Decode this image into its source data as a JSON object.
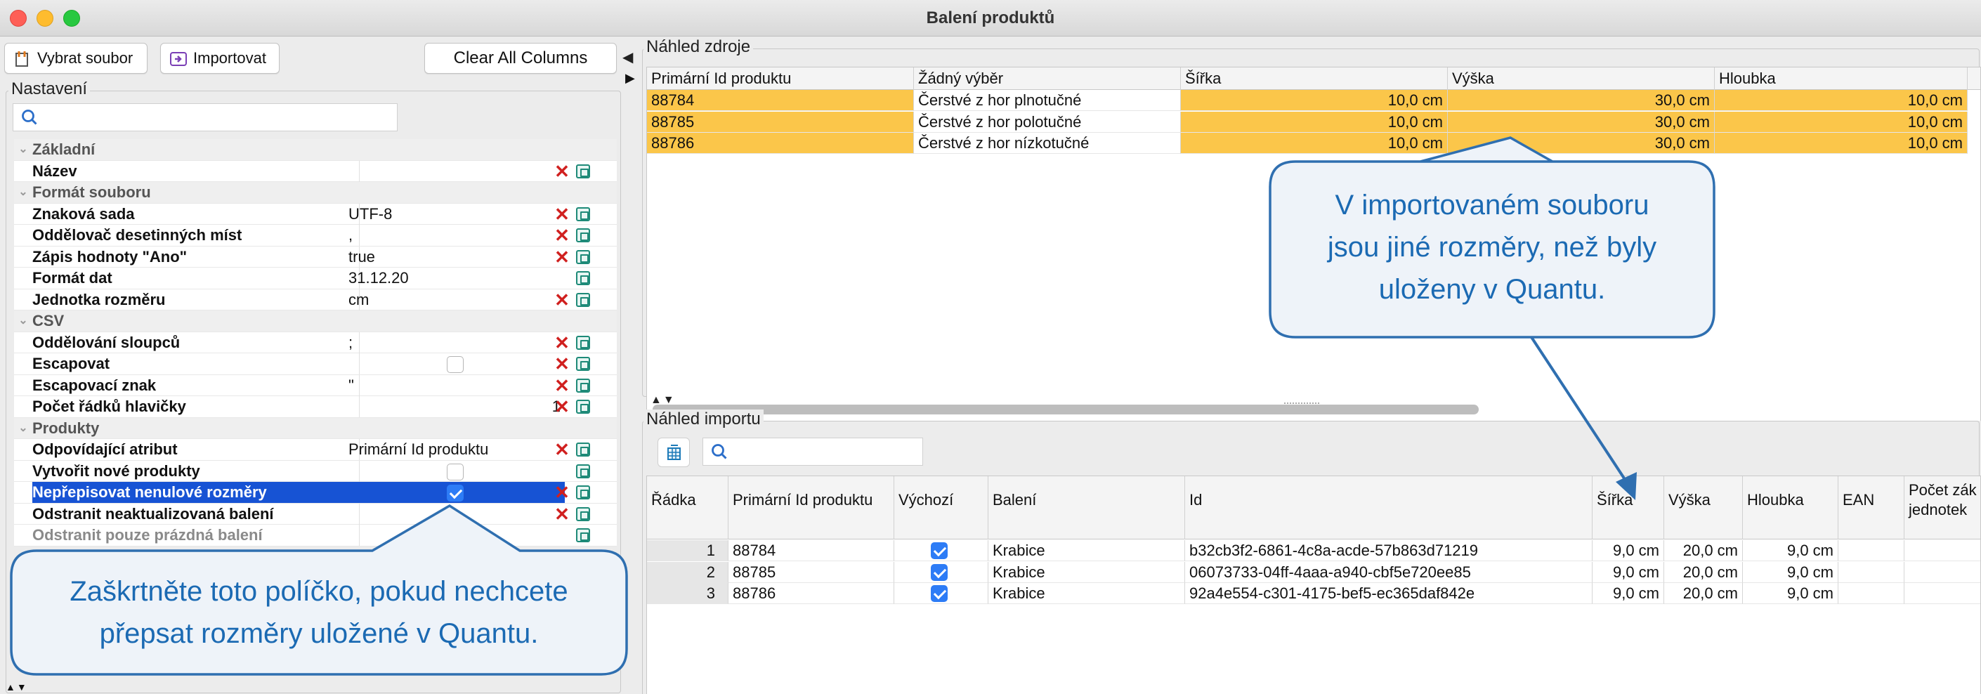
{
  "window": {
    "title": "Balení produktů"
  },
  "toolbar": {
    "select_file": "Vybrat soubor",
    "import": "Importovat",
    "clear_columns": "Clear All Columns"
  },
  "settings": {
    "label": "Nastavení",
    "rows": [
      {
        "type": "section",
        "name": "Základní"
      },
      {
        "type": "prop",
        "name": "Název",
        "value": "",
        "x": true
      },
      {
        "type": "section",
        "name": "Formát souboru"
      },
      {
        "type": "prop",
        "name": "Znaková sada",
        "value": "UTF-8",
        "x": true
      },
      {
        "type": "prop",
        "name": "Oddělovač desetinných míst",
        "value": ",",
        "x": true
      },
      {
        "type": "prop",
        "name": "Zápis hodnoty \"Ano\"",
        "value": "true",
        "x": true
      },
      {
        "type": "prop",
        "name": "Formát dat",
        "value": "31.12.20",
        "x": false
      },
      {
        "type": "prop",
        "name": "Jednotka rozměru",
        "value": "cm",
        "x": true
      },
      {
        "type": "section",
        "name": "CSV"
      },
      {
        "type": "prop",
        "name": "Oddělování sloupců",
        "value": ";",
        "x": true
      },
      {
        "type": "prop",
        "name": "Escapovat",
        "value": "",
        "checkbox": "off",
        "x": true
      },
      {
        "type": "prop",
        "name": "Escapovací znak",
        "value": "\"",
        "x": true
      },
      {
        "type": "prop",
        "name": "Počet řádků hlavičky",
        "value": "1",
        "align": "right",
        "x": true
      },
      {
        "type": "section",
        "name": "Produkty"
      },
      {
        "type": "prop",
        "name": "Odpovídající atribut",
        "value": "Primární Id produktu",
        "x": true
      },
      {
        "type": "prop",
        "name": "Vytvořit nové produkty",
        "value": "",
        "checkbox": "off",
        "x": false
      },
      {
        "type": "prop",
        "name": "Nepřepisovat nenulové rozměry",
        "value": "",
        "checkbox": "on",
        "x": true,
        "selected": true
      },
      {
        "type": "prop",
        "name": "Odstranit neaktualizovaná balení",
        "value": "",
        "x": true
      },
      {
        "type": "prop",
        "name": "Odstranit pouze prázdná balení",
        "value": "",
        "x": false,
        "dim": true
      }
    ]
  },
  "source_preview": {
    "label": "Náhled zdroje",
    "columns": [
      "Primární Id produktu",
      "Žádný výběr",
      "Šířka",
      "Výška",
      "Hloubka"
    ],
    "rows": [
      [
        "88784",
        "Čerstvé z hor plnotučné",
        "10,0 cm",
        "30,0 cm",
        "10,0 cm"
      ],
      [
        "88785",
        "Čerstvé z hor polotučné",
        "10,0 cm",
        "30,0 cm",
        "10,0 cm"
      ],
      [
        "88786",
        "Čerstvé z hor nízkotučné",
        "10,0 cm",
        "30,0 cm",
        "10,0 cm"
      ]
    ]
  },
  "import_preview": {
    "label": "Náhled importu",
    "search_placeholder": "",
    "columns": [
      "Řádka",
      "Primární Id produktu",
      "Výchozí",
      "Balení",
      "Id",
      "Šířka",
      "Výška",
      "Hloubka",
      "EAN",
      "Počet zák jednotek"
    ],
    "rows": [
      {
        "row": "1",
        "id": "88784",
        "default": true,
        "pack": "Krabice",
        "uuid": "b32cb3f2-6861-4c8a-acde-57b863d71219",
        "w": "9,0 cm",
        "h": "20,0 cm",
        "d": "9,0 cm"
      },
      {
        "row": "2",
        "id": "88785",
        "default": true,
        "pack": "Krabice",
        "uuid": "06073733-04ff-4aaa-a940-cbf5e720ee85",
        "w": "9,0 cm",
        "h": "20,0 cm",
        "d": "9,0 cm"
      },
      {
        "row": "3",
        "id": "88786",
        "default": true,
        "pack": "Krabice",
        "uuid": "92a4e554-c301-4175-bef5-ec365daf842e",
        "w": "9,0 cm",
        "h": "20,0 cm",
        "d": "9,0 cm"
      }
    ]
  },
  "callouts": {
    "top_right": [
      "V importovaném souboru",
      "jsou jiné rozměry, než byly",
      "uloženy v Quantu."
    ],
    "bottom_left": [
      "Zaškrtněte toto políčko, pokud nechcete",
      "přepsat rozměry uložené v Quantu."
    ]
  },
  "colors": {
    "highlight": "#fbc64a",
    "selection": "#1753d4",
    "callout_border": "#2f6fb0",
    "callout_fill": "#eef3f9",
    "callout_text": "#1b6ab3"
  }
}
